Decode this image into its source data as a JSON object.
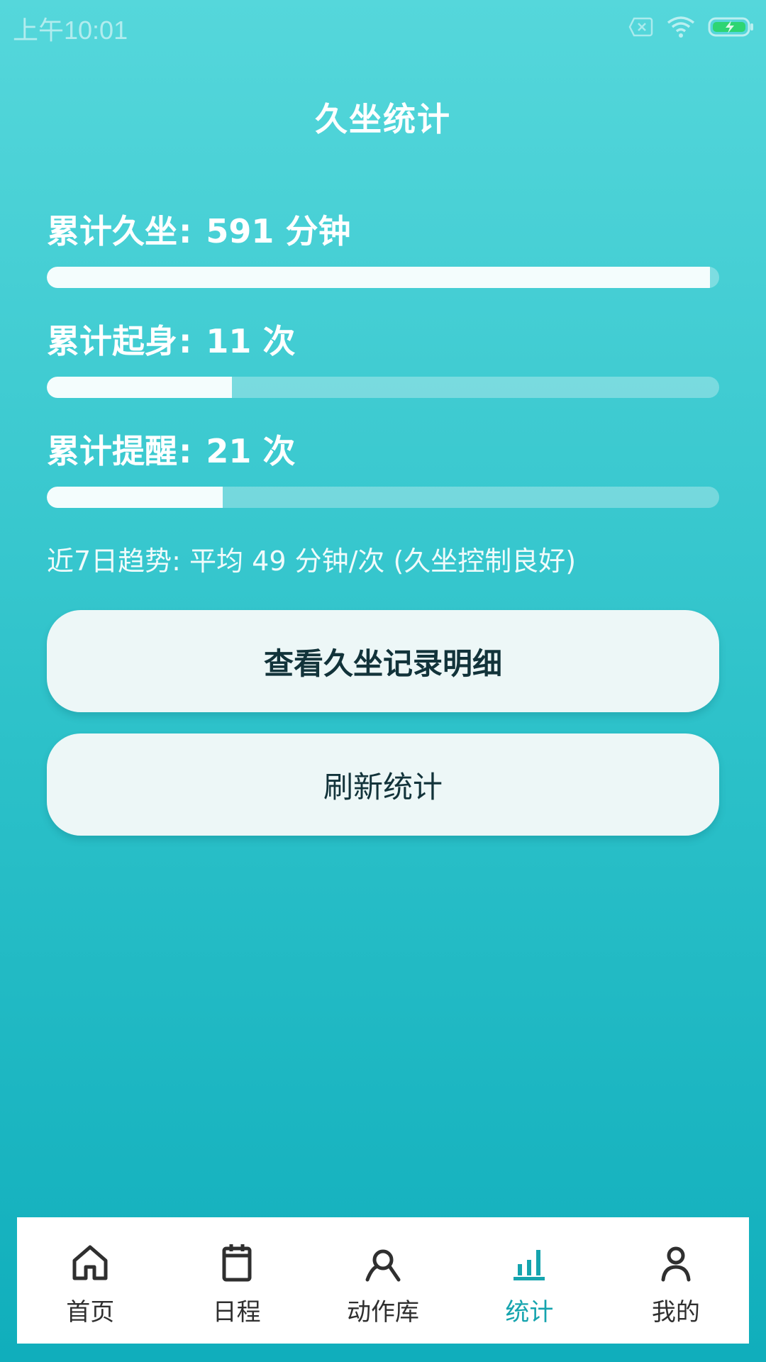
{
  "status_bar": {
    "time": "上午10:01",
    "icons": [
      "sim-x-icon",
      "wifi-icon",
      "battery-charging-icon"
    ],
    "battery_color": "#2ed573"
  },
  "header": {
    "title": "久坐统计"
  },
  "stats": [
    {
      "label": "累计久坐",
      "sep": ":",
      "value": "591",
      "unit": "分钟",
      "progress": 0.986
    },
    {
      "label": "累计起身",
      "sep": ":",
      "value": "11",
      "unit": "次",
      "progress": 0.275
    },
    {
      "label": "累计提醒",
      "sep": ":",
      "value": "21",
      "unit": "次",
      "progress": 0.262
    }
  ],
  "trend": {
    "text": "近7日趋势: 平均 49 分钟/次 (久坐控制良好)"
  },
  "buttons": {
    "view_details": "查看久坐记录明细",
    "refresh": "刷新统计"
  },
  "bottom_nav": {
    "items": [
      {
        "label": "首页",
        "icon": "home-icon",
        "active": false
      },
      {
        "label": "日程",
        "icon": "calendar-icon",
        "active": false
      },
      {
        "label": "动作库",
        "icon": "search-person-icon",
        "active": false
      },
      {
        "label": "统计",
        "icon": "bar-chart-icon",
        "active": true
      },
      {
        "label": "我的",
        "icon": "user-icon",
        "active": false
      }
    ],
    "active_color": "#15a4ae"
  },
  "colors": {
    "background_top": "#55d7db",
    "background_bottom": "#10aebc",
    "button_bg": "#edf7f7"
  }
}
